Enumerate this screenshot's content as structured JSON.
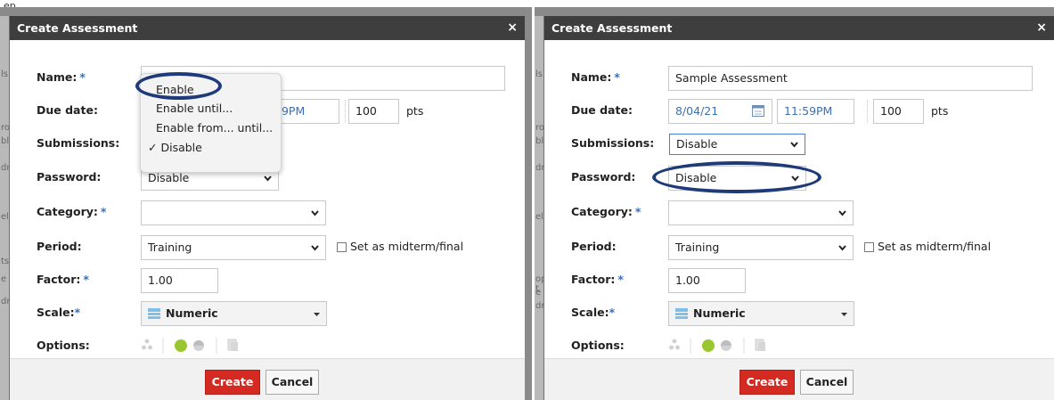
{
  "top_stub_text": "ep",
  "left": {
    "title": "Create Assessment",
    "close": "×",
    "name_label": "Name:",
    "name_required": "*",
    "name_value": "",
    "due_label": "Due date:",
    "due_time_partial": "59PM",
    "points_value": "100",
    "pts_label": "pts",
    "submissions_label": "Submissions:",
    "password_label": "Password:",
    "password_value": "Disable",
    "category_label": "Category:",
    "category_required": "*",
    "category_value": "",
    "period_label": "Period:",
    "period_value": "Training",
    "midterm_label": "Set as midterm/final",
    "factor_label": "Factor:",
    "factor_required": "*",
    "factor_value": "1.00",
    "scale_label": "Scale:",
    "scale_required": "*",
    "scale_value": "Numeric",
    "options_label": "Options:",
    "create_label": "Create",
    "cancel_label": "Cancel",
    "dropdown": {
      "items": [
        "Enable",
        "Enable until...",
        "Enable from... until...",
        "Disable"
      ],
      "checked": "✓"
    }
  },
  "right": {
    "title": "Create Assessment",
    "close": "×",
    "name_label": "Name:",
    "name_required": "*",
    "name_value": "Sample Assessment",
    "due_label": "Due date:",
    "due_date_value": "8/04/21",
    "due_time_value": "11:59PM",
    "points_value": "100",
    "pts_label": "pts",
    "submissions_label": "Submissions:",
    "submissions_value": "Disable",
    "password_label": "Password:",
    "password_value": "Disable",
    "category_label": "Category:",
    "category_required": "*",
    "category_value": "",
    "period_label": "Period:",
    "period_value": "Training",
    "midterm_label": "Set as midterm/final",
    "factor_label": "Factor:",
    "factor_required": "*",
    "factor_value": "1.00",
    "scale_label": "Scale:",
    "scale_required": "*",
    "scale_value": "Numeric",
    "options_label": "Options:",
    "create_label": "Create",
    "cancel_label": "Cancel"
  },
  "icons": {
    "calendar": "calendar-icon",
    "chevron": "chevron-down-icon",
    "scale_swatch": "numeric-scale-icon",
    "options": [
      "dots-icon",
      "green-circle-icon",
      "gray-circle-icon",
      "clipboard-icon"
    ]
  },
  "colors": {
    "titlebar": "#3e3e3e",
    "create_button": "#d42a22",
    "required_star": "#3a6fb5",
    "highlight_ellipse": "#1f3a78",
    "option_green": "#9ac72f"
  }
}
